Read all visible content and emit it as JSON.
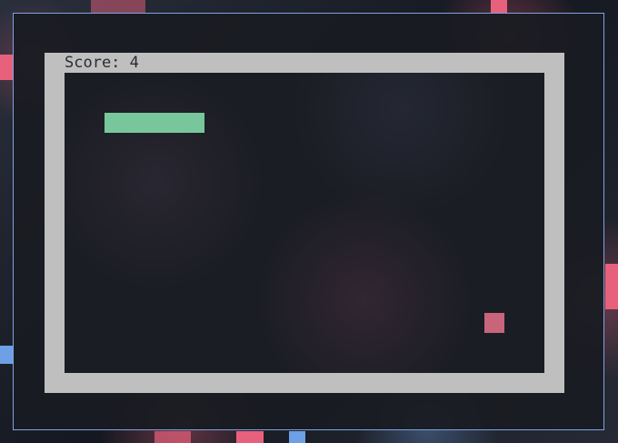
{
  "game": {
    "score_text": "Score: 4",
    "snake_color": "#78c79c",
    "food_color": "#c8657b",
    "board_border_color": "#bfbfbf",
    "window_border_color": "#7fa2e0"
  }
}
